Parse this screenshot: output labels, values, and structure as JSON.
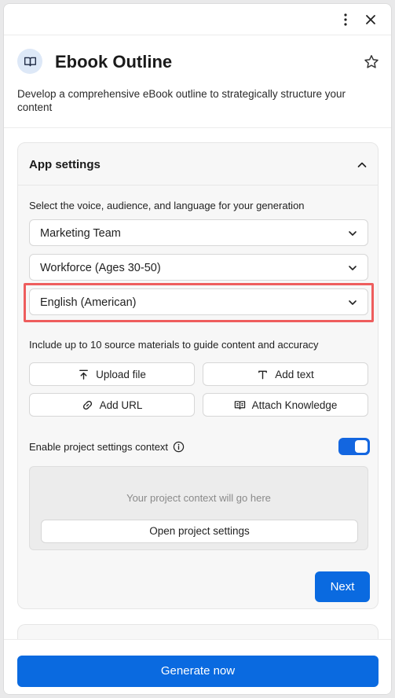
{
  "app": {
    "title": "Ebook Outline",
    "description": "Develop a comprehensive eBook outline to strategically structure your content"
  },
  "settings": {
    "header": "App settings",
    "voice_prompt": "Select the voice, audience, and language for your generation",
    "voice": "Marketing Team",
    "audience": "Workforce (Ages 30-50)",
    "language": "English (American)",
    "sources_prompt": "Include up to 10 source materials to guide content and accuracy",
    "buttons": {
      "upload": "Upload file",
      "text": "Add text",
      "url": "Add URL",
      "knowledge": "Attach Knowledge"
    },
    "context_label": "Enable project settings context",
    "context_enabled": true,
    "context_placeholder": "Your project context will go here",
    "open_settings": "Open project settings",
    "next": "Next"
  },
  "footer": {
    "generate": "Generate now"
  },
  "colors": {
    "primary": "#0a6ae0",
    "highlight": "#ee5d5d",
    "badge": "#dde8f7"
  },
  "icons": [
    "kebab-menu-icon",
    "close-icon",
    "book-icon",
    "star-icon",
    "chevron-up-icon",
    "chevron-down-icon",
    "upload-icon",
    "text-icon",
    "link-icon",
    "knowledge-icon",
    "info-icon"
  ]
}
